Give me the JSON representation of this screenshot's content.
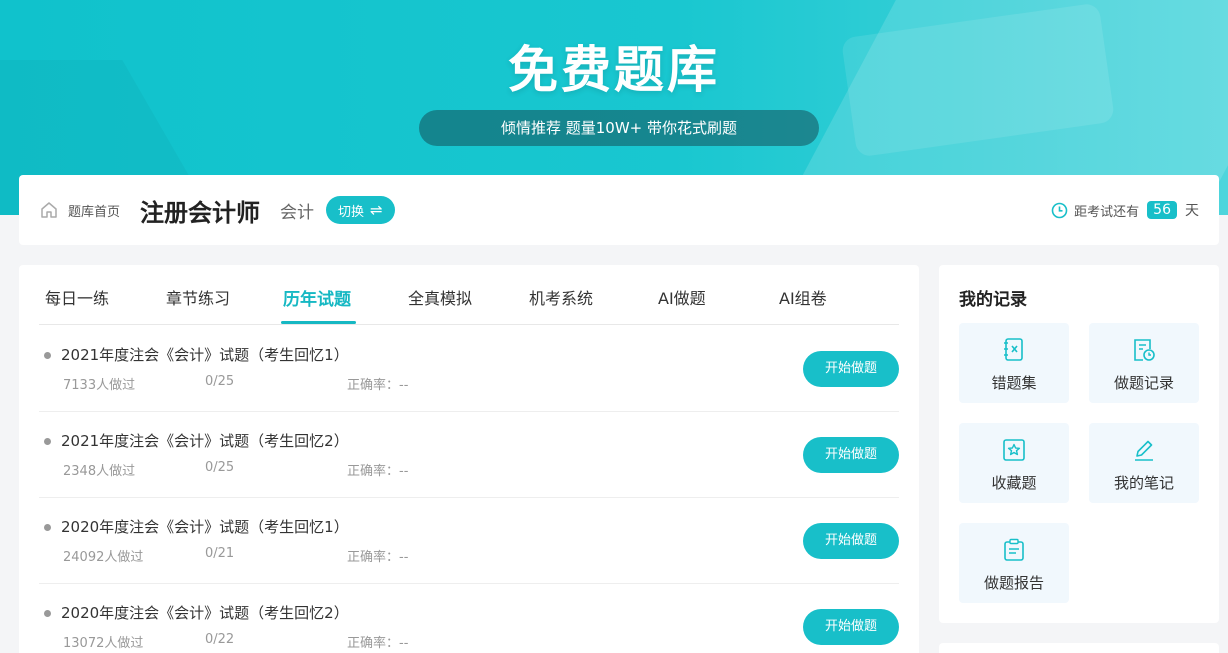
{
  "hero": {
    "title": "免费题库",
    "subtitle": "倾情推荐 题量10W+ 带你花式刷题"
  },
  "topbar": {
    "home_label": "题库首页",
    "course": "注册会计师",
    "subject": "会计",
    "switch_label": "切换",
    "switch_icon": "⇌",
    "countdown_prefix": "距考试还有",
    "days": "56",
    "days_unit": "天"
  },
  "tabs": [
    {
      "label": "每日一练"
    },
    {
      "label": "章节练习"
    },
    {
      "label": "历年试题"
    },
    {
      "label": "全真模拟"
    },
    {
      "label": "机考系统"
    },
    {
      "label": "AI做题"
    },
    {
      "label": "AI组卷"
    }
  ],
  "active_tab": "历年试题",
  "papers": [
    {
      "title": "2021年度注会《会计》试题（考生回忆1）",
      "done": "7133人做过",
      "progress": "0/25",
      "accuracy": "正确率：--",
      "button": "开始做题"
    },
    {
      "title": "2021年度注会《会计》试题（考生回忆2）",
      "done": "2348人做过",
      "progress": "0/25",
      "accuracy": "正确率：--",
      "button": "开始做题"
    },
    {
      "title": "2020年度注会《会计》试题（考生回忆1）",
      "done": "24092人做过",
      "progress": "0/21",
      "accuracy": "正确率：--",
      "button": "开始做题"
    },
    {
      "title": "2020年度注会《会计》试题（考生回忆2）",
      "done": "13072人做过",
      "progress": "0/22",
      "accuracy": "正确率：--",
      "button": "开始做题"
    }
  ],
  "records": {
    "title": "我的记录",
    "items": [
      {
        "label": "错题集",
        "icon": "wrong-book-icon"
      },
      {
        "label": "做题记录",
        "icon": "history-icon"
      },
      {
        "label": "收藏题",
        "icon": "star-icon"
      },
      {
        "label": "我的笔记",
        "icon": "pencil-icon"
      },
      {
        "label": "做题报告",
        "icon": "report-icon"
      }
    ]
  },
  "colors": {
    "accent": "#18bfc9",
    "hero": "#10c2cc",
    "tile_bg": "#f1f8fd"
  }
}
